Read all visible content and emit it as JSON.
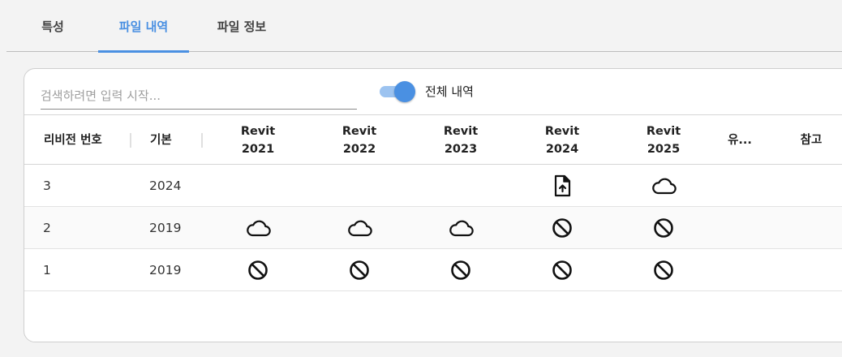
{
  "tabs": [
    {
      "label": "특성",
      "active": false
    },
    {
      "label": "파일 내역",
      "active": true
    },
    {
      "label": "파일 정보",
      "active": false
    }
  ],
  "search": {
    "placeholder": "검색하려면 입력 시작...",
    "value": ""
  },
  "toggle": {
    "label": "전체 내역",
    "on": true
  },
  "table": {
    "headers": {
      "revision": "리비전 번호",
      "base": "기본",
      "revit2021": [
        "Revit",
        "2021"
      ],
      "revit2022": [
        "Revit",
        "2022"
      ],
      "revit2023": [
        "Revit",
        "2023"
      ],
      "revit2024": [
        "Revit",
        "2024"
      ],
      "revit2025": [
        "Revit",
        "2025"
      ],
      "type": "유...",
      "note": "참고"
    },
    "rows": [
      {
        "revision": "3",
        "base": "2024",
        "icons": [
          "",
          "",
          "",
          "file-upload-icon",
          "cloud-icon"
        ]
      },
      {
        "revision": "2",
        "base": "2019",
        "icons": [
          "cloud-icon",
          "cloud-icon",
          "cloud-icon",
          "blocked-icon",
          "blocked-icon"
        ]
      },
      {
        "revision": "1",
        "base": "2019",
        "icons": [
          "blocked-icon",
          "blocked-icon",
          "blocked-icon",
          "blocked-icon",
          "blocked-icon"
        ]
      }
    ]
  },
  "colors": {
    "accent": "#4a90e2",
    "toggle_track": "#9cc3f0"
  }
}
